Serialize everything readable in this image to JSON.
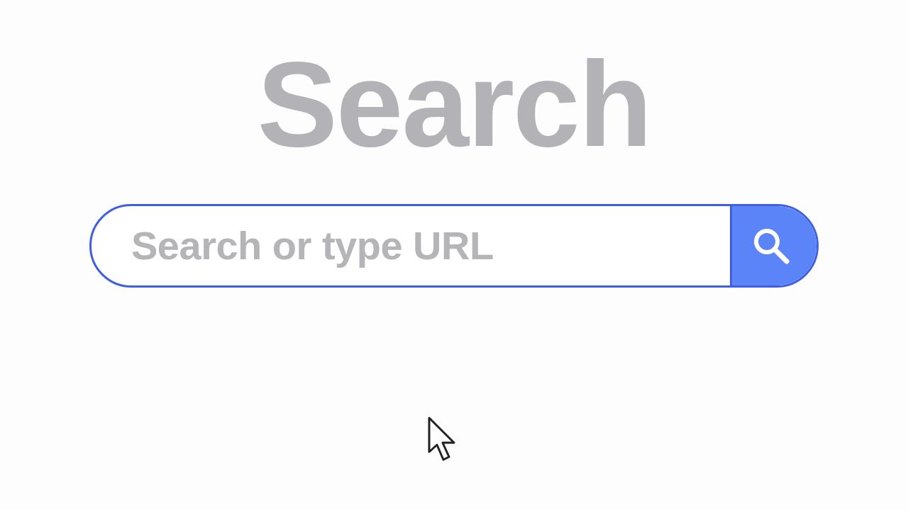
{
  "title": "Search",
  "search": {
    "placeholder": "Search or type URL"
  }
}
